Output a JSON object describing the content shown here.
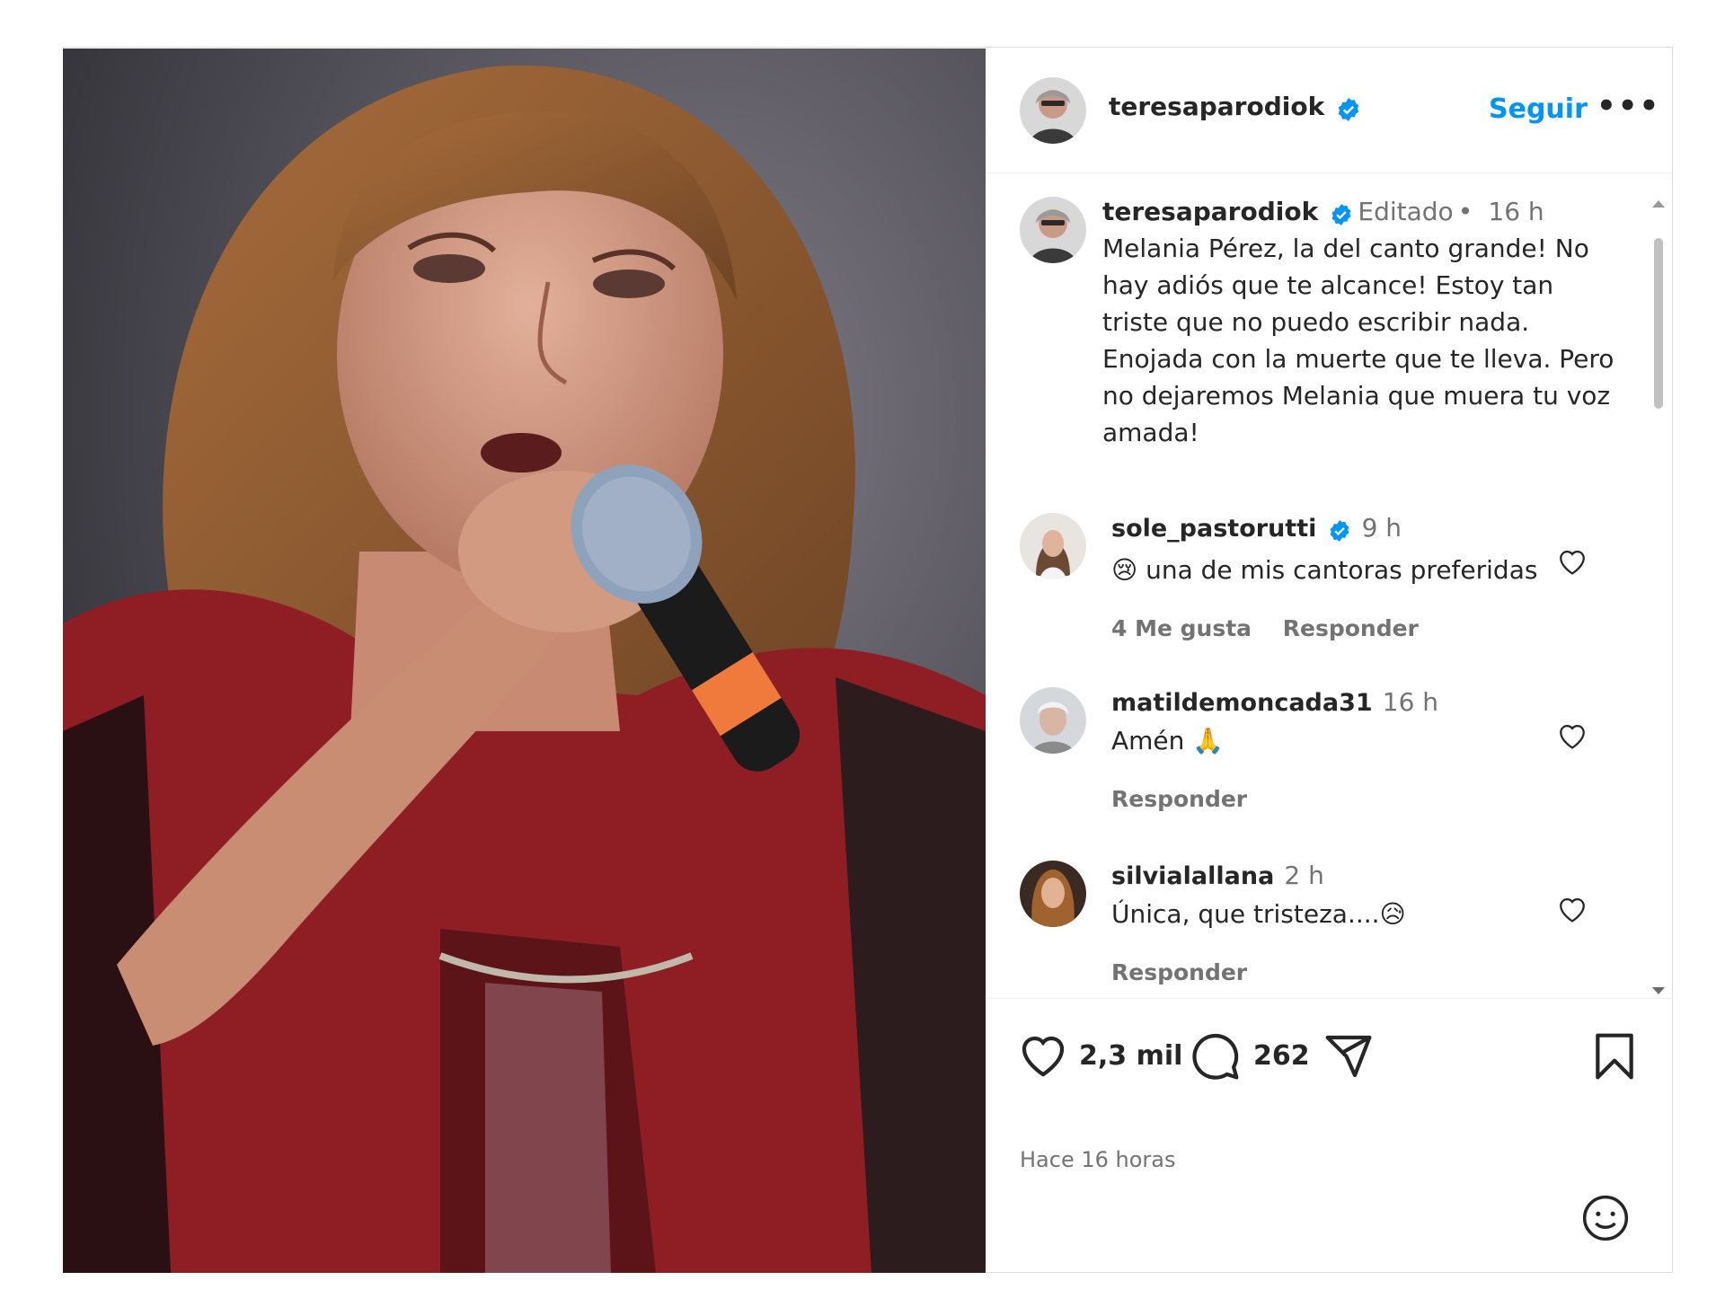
{
  "post": {
    "username": "teresaparodiok",
    "follow_label": "Seguir",
    "more_label": "•••",
    "caption": {
      "username": "teresaparodiok",
      "edited": "Editado",
      "dot": "•",
      "time": "16 h",
      "text": "Melania Pérez, la del canto grande!  No hay adiós que te  alcance! Estoy tan triste que no puedo escribir nada. Enojada con la muerte que te lleva. Pero no dejaremos Melania que muera tu voz amada!"
    },
    "comments": [
      {
        "username": "sole_pastorutti",
        "verified": true,
        "time": "9 h",
        "text": "😢 una de mis cantoras preferidas",
        "likes": "4 Me gusta",
        "reply": "Responder"
      },
      {
        "username": "matildemoncada31",
        "verified": false,
        "time": "16 h",
        "text": "Amén 🙏",
        "likes": "",
        "reply": "Responder"
      },
      {
        "username": "silvialallana",
        "verified": false,
        "time": "2 h",
        "text": "Única, que tristeza....😥",
        "likes": "",
        "reply": "Responder"
      }
    ],
    "like_count": "2,3 mil",
    "comment_count": "262",
    "ago": "Hace 16 horas"
  },
  "colors": {
    "accent": "#0095f6",
    "verified": "#0095f6",
    "muted": "#737373"
  },
  "icons": [
    "verified-icon",
    "more-icon",
    "heart-icon",
    "comment-icon",
    "share-icon",
    "bookmark-icon",
    "emoji-icon"
  ]
}
